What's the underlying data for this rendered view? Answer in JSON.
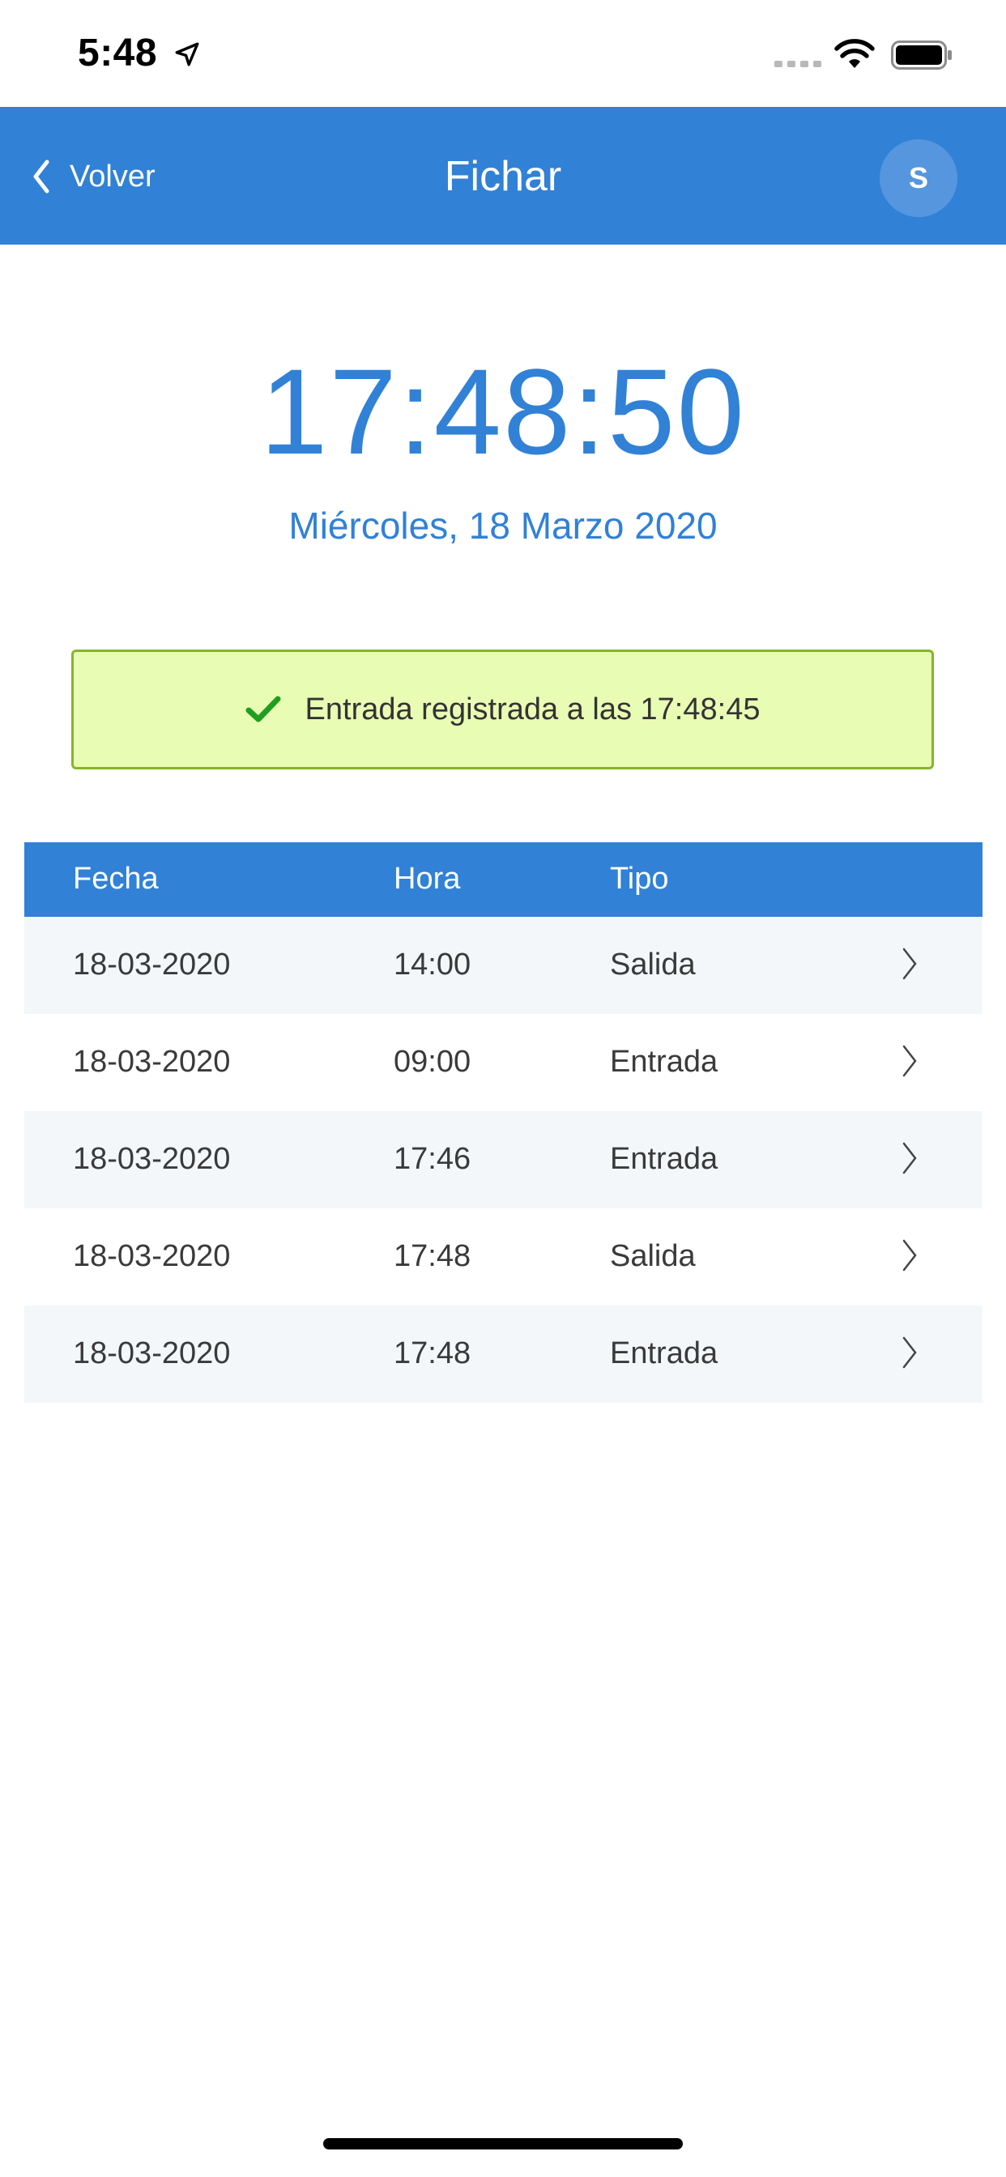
{
  "status_bar": {
    "time": "5:48"
  },
  "navbar": {
    "back_label": "Volver",
    "title": "Fichar",
    "avatar_initial": "S"
  },
  "clock": {
    "time": "17:48:50",
    "date": "Miércoles, 18 Marzo 2020"
  },
  "alert": {
    "message": "Entrada registrada a las 17:48:45",
    "icon": "check-icon"
  },
  "table": {
    "headers": {
      "fecha": "Fecha",
      "hora": "Hora",
      "tipo": "Tipo"
    },
    "rows": [
      {
        "fecha": "18-03-2020",
        "hora": "14:00",
        "tipo": "Salida"
      },
      {
        "fecha": "18-03-2020",
        "hora": "09:00",
        "tipo": "Entrada"
      },
      {
        "fecha": "18-03-2020",
        "hora": "17:46",
        "tipo": "Entrada"
      },
      {
        "fecha": "18-03-2020",
        "hora": "17:48",
        "tipo": "Salida"
      },
      {
        "fecha": "18-03-2020",
        "hora": "17:48",
        "tipo": "Entrada"
      }
    ]
  },
  "colors": {
    "accent": "#3181d6",
    "alert_bg": "#e9fcb4",
    "alert_border": "#86b52a",
    "check": "#1f9e1f",
    "row_alt": "#f3f7fa"
  }
}
